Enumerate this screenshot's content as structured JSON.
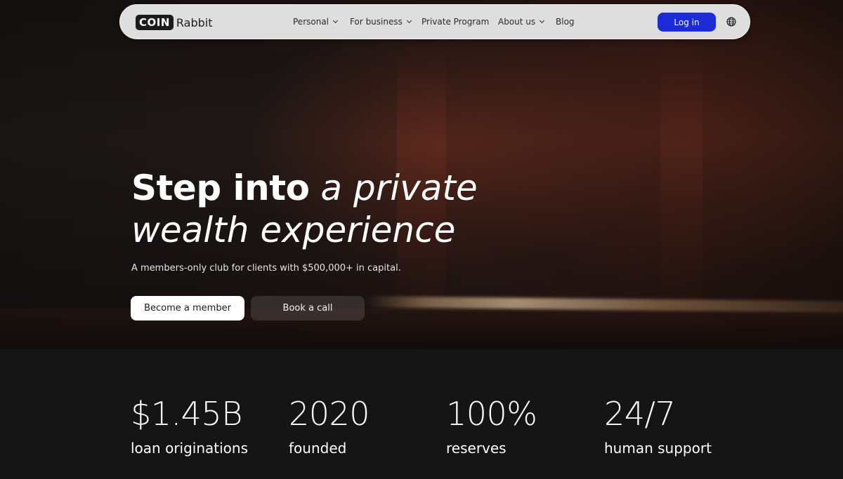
{
  "nav": {
    "logo_coin": "COIN",
    "logo_rabbit": "Rabbit",
    "items": [
      {
        "label": "Personal"
      },
      {
        "label": "For business"
      },
      {
        "label": "Private Program"
      },
      {
        "label": "About us"
      },
      {
        "label": "Blog"
      }
    ],
    "login_label": "Log in",
    "globe_icon": "globe-icon",
    "accent_color": "#1d2bd6"
  },
  "hero": {
    "headline_strong": "Step into",
    "headline_light": "a private",
    "headline_line2": "wealth experience",
    "subtitle": "A members-only club for clients with $500,000+ in capital.",
    "primary_button": "Become a member",
    "secondary_button": "Book a call"
  },
  "stats": [
    {
      "value": "$1.45B",
      "label": "loan originations"
    },
    {
      "value": "2020",
      "label": "founded"
    },
    {
      "value": "100%",
      "label": "reserves"
    },
    {
      "value": "24/7",
      "label": "human support"
    }
  ]
}
